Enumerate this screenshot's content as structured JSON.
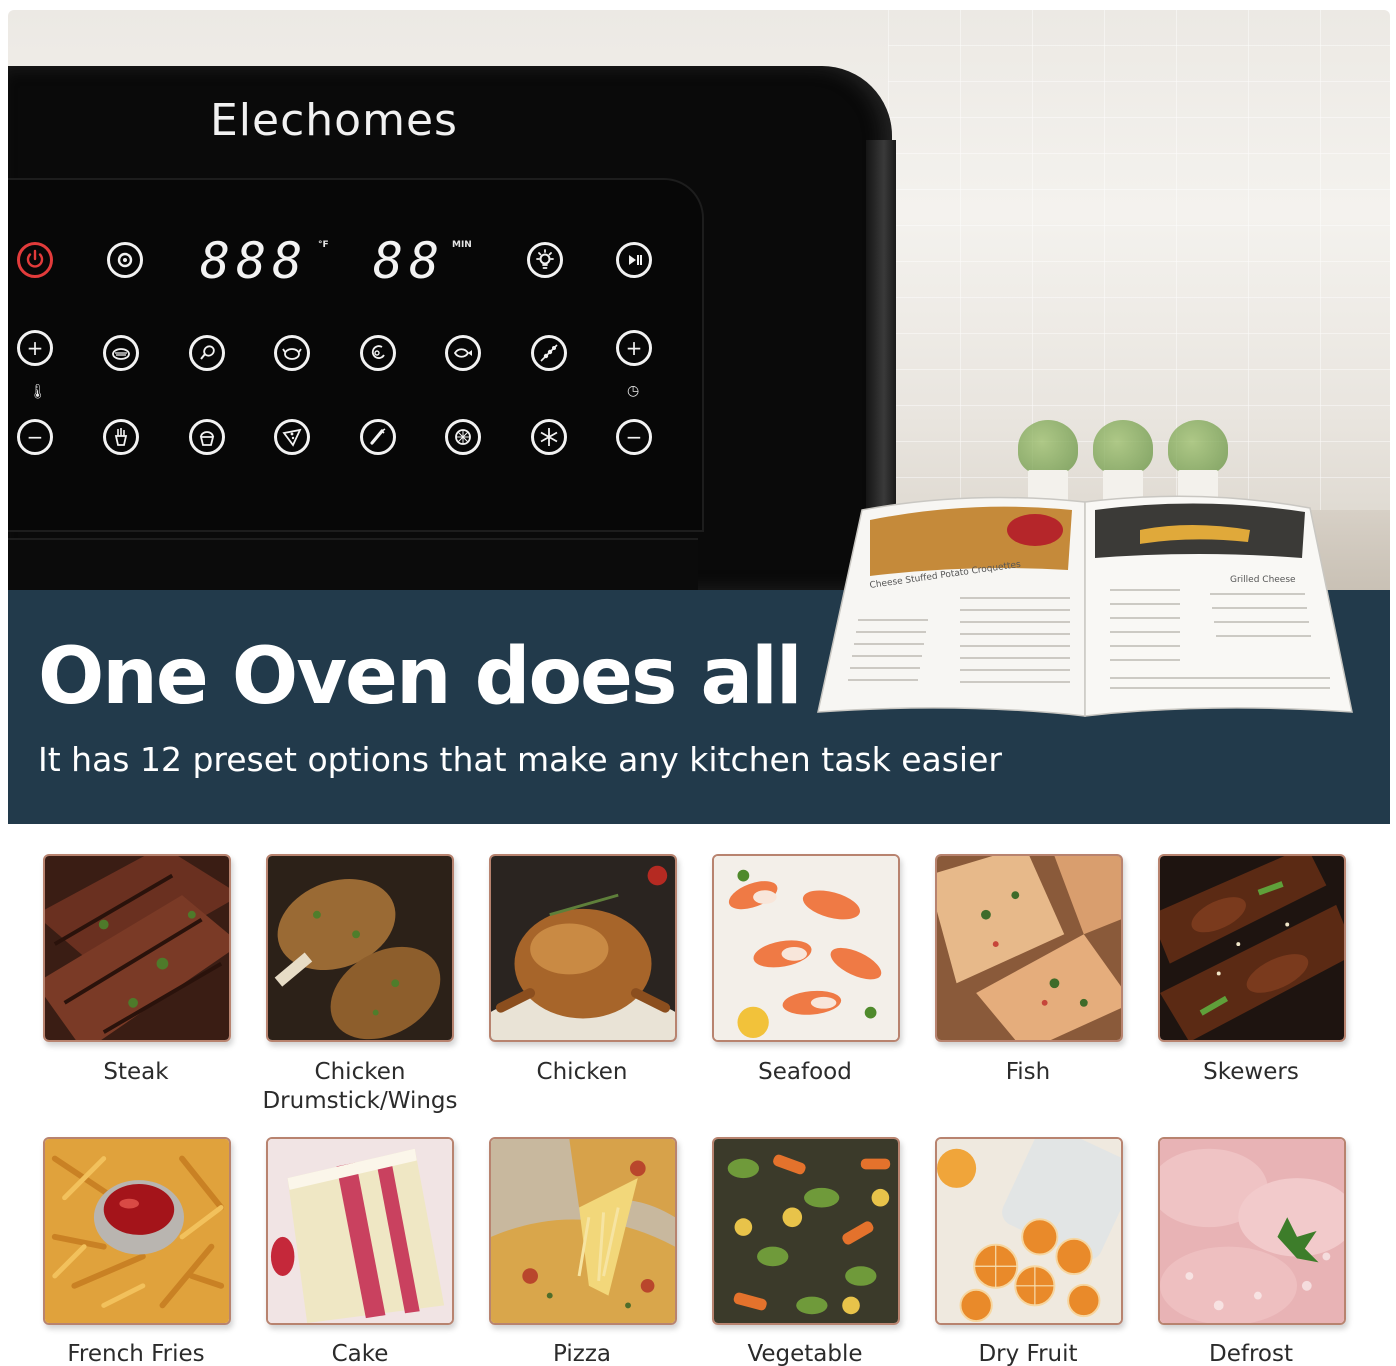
{
  "brand": "Elechomes",
  "display": {
    "temperature_digits": "888",
    "temperature_unit": "°F",
    "time_digits": "88",
    "time_unit": "MIN"
  },
  "banner": {
    "headline": "One Oven does all",
    "subline": "It has 12 preset options that make any kitchen task easier"
  },
  "recipe_book": {
    "left_page_title": "Cheese Stuffed Potato Croquettes",
    "right_page_title": "Grilled Cheese"
  },
  "presets": [
    {
      "label": "Steak",
      "icon": "steak-photo"
    },
    {
      "label": "Chicken Drumstick/Wings",
      "icon": "drumstick-photo"
    },
    {
      "label": "Chicken",
      "icon": "roast-chicken-photo"
    },
    {
      "label": "Seafood",
      "icon": "seafood-photo"
    },
    {
      "label": "Fish",
      "icon": "fish-photo"
    },
    {
      "label": "Skewers",
      "icon": "skewers-photo"
    },
    {
      "label": "French Fries",
      "icon": "french-fries-photo"
    },
    {
      "label": "Cake",
      "icon": "cake-photo"
    },
    {
      "label": "Pizza",
      "icon": "pizza-photo"
    },
    {
      "label": "Vegetable",
      "icon": "vegetable-photo"
    },
    {
      "label": "Dry Fruit",
      "icon": "dry-fruit-photo"
    },
    {
      "label": "Defrost",
      "icon": "defrost-photo"
    }
  ],
  "colors": {
    "banner": "#223a4b",
    "oven": "#0a0a0a",
    "power_button": "#e23b3b",
    "tile_border": "#b8836f"
  }
}
